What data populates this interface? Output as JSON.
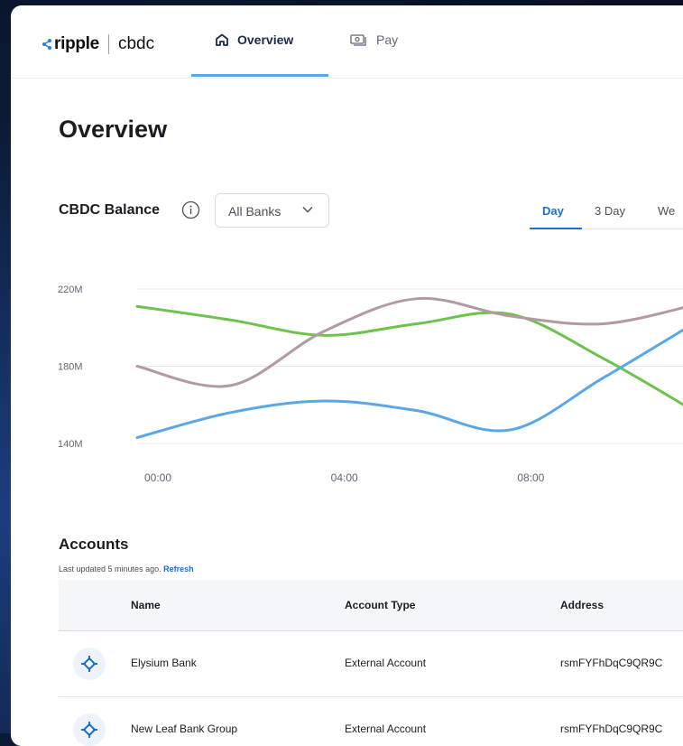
{
  "header": {
    "logo_text": "ripple",
    "product_text": "cbdc",
    "tabs": [
      {
        "label": "Overview",
        "icon": "home-icon"
      },
      {
        "label": "Pay",
        "icon": "cash-icon"
      }
    ]
  },
  "page_title": "Overview",
  "balance": {
    "title": "CBDC Balance",
    "bank_filter": "All Banks",
    "ranges": [
      "Day",
      "3 Day",
      "We"
    ],
    "active_range": "Day"
  },
  "colors": {
    "accent": "#1f6fc4",
    "series_blue": "#5aa7e8",
    "series_green": "#6cc24a",
    "series_mauve": "#b39aa2"
  },
  "chart_data": {
    "type": "line",
    "x_ticks": [
      "00:00",
      "04:00",
      "08:00"
    ],
    "y_ticks": [
      "220M",
      "180M",
      "140M"
    ],
    "ylim": [
      140,
      220
    ],
    "x": [
      0,
      2,
      4,
      6,
      8,
      10,
      12
    ],
    "series": [
      {
        "color": "#6cc24a",
        "values": [
          211,
          204,
          196,
          202,
          207,
          184,
          156
        ]
      },
      {
        "color": "#b39aa2",
        "values": [
          180,
          170,
          198,
          215,
          206,
          202,
          212
        ]
      },
      {
        "color": "#5aa7e8",
        "values": [
          143,
          156,
          162,
          157,
          147,
          174,
          203
        ]
      }
    ],
    "grid": true
  },
  "accounts": {
    "title": "Accounts",
    "updated_text": "Last updated 5 minutes ago.",
    "refresh_label": "Refresh",
    "columns": [
      "Name",
      "Account Type",
      "Address"
    ],
    "rows": [
      {
        "name": "Elysium Bank",
        "type": "External Account",
        "address": "rsmFYFhDqC9QR9C"
      },
      {
        "name": "New Leaf Bank Group",
        "type": "External Account",
        "address": "rsmFYFhDqC9QR9C"
      }
    ]
  }
}
